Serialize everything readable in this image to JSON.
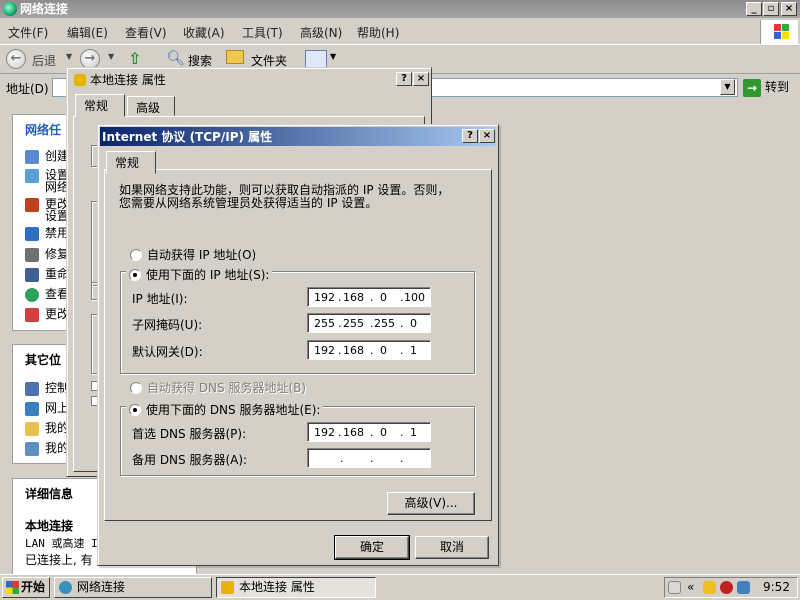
{
  "explorer": {
    "title": "网络连接",
    "menu": [
      "文件(F)",
      "编辑(E)",
      "查看(V)",
      "收藏(A)",
      "工具(T)",
      "高级(N)",
      "帮助(H)"
    ],
    "toolbar": {
      "back": "后退",
      "search": "搜索",
      "folders": "文件夹"
    },
    "address_label": "地址(D)",
    "go_label": "转到",
    "tasks_header": "网络任",
    "tasks": [
      "创建",
      "设置",
      "网络",
      "更改",
      "设置",
      "禁用",
      "修复",
      "重命",
      "查看",
      "更改"
    ],
    "other_header": "其它位",
    "other_items": [
      "控制",
      "网上",
      "我的",
      "我的"
    ],
    "details_header": "详细信息",
    "details_name": "本地连接",
    "details_line1": "LAN 或高速 I",
    "details_line2": "已连接上, 有"
  },
  "props": {
    "title": "本地连接 属性",
    "tabs": [
      "常规",
      "高级"
    ]
  },
  "tcp": {
    "title": "Internet 协议 (TCP/IP) 属性",
    "tab": "常规",
    "desc_line1": "如果网络支持此功能，则可以获取自动指派的 IP 设置。否则，",
    "desc_line2": "您需要从网络系统管理员处获得适当的 IP 设置。",
    "auto_ip": "自动获得 IP 地址(O)",
    "manual_ip": "使用下面的 IP 地址(S):",
    "ip_label": "IP 地址(I):",
    "mask_label": "子网掩码(U):",
    "gw_label": "默认网关(D):",
    "ip": [
      "192",
      "168",
      "0",
      "100"
    ],
    "mask": [
      "255",
      "255",
      "255",
      "0"
    ],
    "gateway": [
      "192",
      "168",
      "0",
      "1"
    ],
    "auto_dns": "自动获得 DNS 服务器地址(B)",
    "manual_dns": "使用下面的 DNS 服务器地址(E):",
    "dns1_label": "首选 DNS 服务器(P):",
    "dns2_label": "备用 DNS 服务器(A):",
    "dns1": [
      "192",
      "168",
      "0",
      "1"
    ],
    "dns2": [
      "",
      "",
      "",
      ""
    ],
    "advanced": "高级(V)...",
    "ok": "确定",
    "cancel": "取消"
  },
  "taskbar": {
    "start": "开始",
    "task1": "网络连接",
    "task2": "本地连接 属性",
    "clock": "9:52",
    "tray_chevron": "«"
  }
}
